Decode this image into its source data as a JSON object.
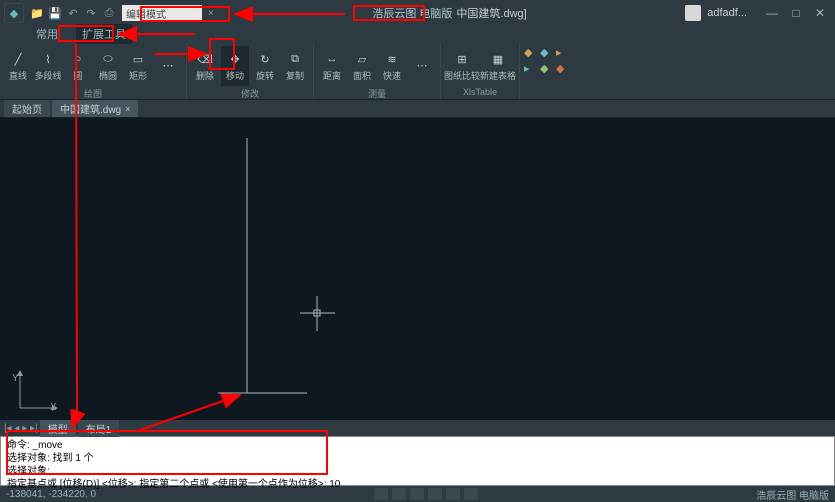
{
  "title": {
    "search_text": "编辑模式",
    "product_name": "浩辰云图 电脑版",
    "file_suffix": "中国建筑.dwg]",
    "user_name": "adfadf...",
    "win_min": "—",
    "win_max": "□",
    "win_close": "✕"
  },
  "tabs": {
    "common": "常用",
    "expand": "扩展工具"
  },
  "ribbon": {
    "draw": {
      "line": "直线",
      "polyline": "多段线",
      "circle": "圆",
      "ellipse": "椭圆",
      "rect": "矩形",
      "group_label": "绘图"
    },
    "modify": {
      "erase": "删除",
      "move": "移动",
      "rotate": "旋转",
      "copy": "复制",
      "group_label": "修改"
    },
    "measure": {
      "distance": "距离",
      "area": "面积",
      "quick": "快速",
      "group_label": "测量"
    },
    "compare": {
      "paper": "图纸比较",
      "new": "新建表格",
      "table": "XlsTable",
      "group_label": "图纸比较"
    }
  },
  "doc_tabs": {
    "start": "起始页",
    "file": "中国建筑.dwg",
    "close": "×"
  },
  "canvas": {
    "x_label": "X",
    "y_label": "Y"
  },
  "model_tabs": {
    "model": "模型",
    "layout": "布局1"
  },
  "command": {
    "line1": "命令: _move",
    "line2": "选择对象: 找到 1 个",
    "line3": "选择对象:",
    "line4": "指定基点或 [位移(D)] <位移>:   指定第二个点或 <使用第一个点作为位移>: 10"
  },
  "status": {
    "coords": "-138041, -234220, 0",
    "brand": "浩辰云图 电脑版"
  }
}
